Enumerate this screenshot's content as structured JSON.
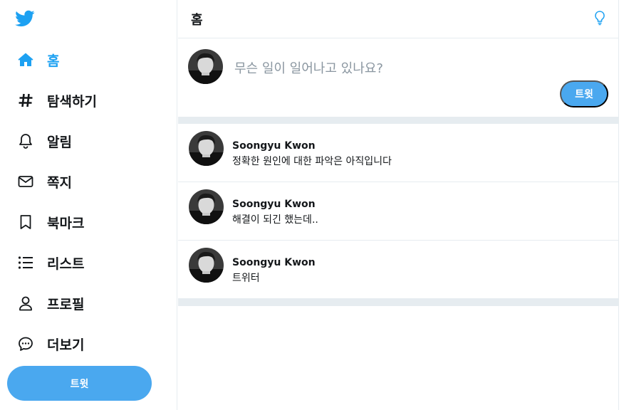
{
  "colors": {
    "accent": "#1da1f2",
    "button": "#4aa8ef",
    "divider": "#e6ecf0"
  },
  "sidebar": {
    "logo_icon": "twitter-bird-icon",
    "items": [
      {
        "label": "홈",
        "icon": "home-icon",
        "active": true
      },
      {
        "label": "탐색하기",
        "icon": "hashtag-icon",
        "active": false
      },
      {
        "label": "알림",
        "icon": "bell-icon",
        "active": false
      },
      {
        "label": "쪽지",
        "icon": "envelope-icon",
        "active": false
      },
      {
        "label": "북마크",
        "icon": "bookmark-icon",
        "active": false
      },
      {
        "label": "리스트",
        "icon": "list-icon",
        "active": false
      },
      {
        "label": "프로필",
        "icon": "user-icon",
        "active": false
      },
      {
        "label": "더보기",
        "icon": "more-chat-icon",
        "active": false
      }
    ],
    "tweet_button": "트윗"
  },
  "main": {
    "header_title": "홈",
    "header_icon": "lightbulb-icon",
    "compose": {
      "placeholder": "무슨 일이 일어나고 있나요?",
      "button": "트윗"
    },
    "tweets": [
      {
        "name": "Soongyu Kwon",
        "text": "정확한 원인에 대한 파악은 아직입니다"
      },
      {
        "name": "Soongyu Kwon",
        "text": "해결이 되긴 했는데.."
      },
      {
        "name": "Soongyu Kwon",
        "text": "트위터"
      }
    ]
  }
}
